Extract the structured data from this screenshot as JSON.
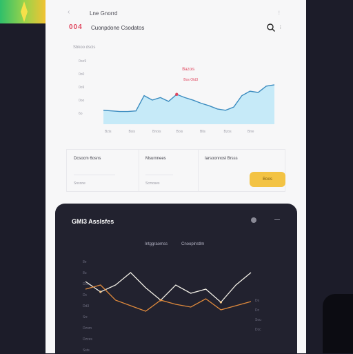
{
  "topbar": {
    "back_icon": "‹",
    "title": "Lne Gnorrd",
    "menu_icon": "⁝"
  },
  "header": {
    "logo": "004",
    "app_name": "Cuonpdone Csodatos"
  },
  "subtitle": "Sbkoo dscis",
  "chart1": {
    "y_ticks": [
      "0oo9",
      "0o0",
      "0o9",
      "0oo",
      "6o"
    ],
    "x_ticks": [
      "Bzis",
      "Bsis",
      "Bnois",
      "Bois",
      "Blis",
      "Bzos",
      "Brre"
    ],
    "annotation": {
      "title": "Bazois",
      "sub": "Bos Otd3"
    },
    "values": [
      22,
      21,
      20,
      20,
      21,
      45,
      38,
      42,
      36,
      47,
      42,
      38,
      33,
      29,
      24,
      22,
      27,
      45,
      52,
      50,
      60,
      62
    ],
    "colors": {
      "line": "#3a8bbf",
      "fill": "#c6eaf8",
      "marker": "#e0475f"
    }
  },
  "stats": [
    {
      "label": "Dcsocm 6osns",
      "sub": "Snxone"
    },
    {
      "label": "Msurnnees",
      "sub": "Scmoses"
    },
    {
      "label": "Iarsoonnosl Brsss",
      "sub": ""
    }
  ],
  "button": {
    "label": "Boos"
  },
  "dark_panel": {
    "title": "GMl3 Asslsfes",
    "tabs": [
      "Intggraomss",
      "Cnooplnstlm"
    ],
    "y_ticks": [
      "8e",
      "8u",
      "Dcs",
      "Dc",
      "Dd3",
      "Sn:",
      "Dzom",
      "Dzzes",
      "Ssts"
    ],
    "right_ticks": [
      "Ds",
      "Dc",
      "Sou",
      "Dzc"
    ],
    "series": [
      {
        "name": "",
        "color": "#f2efe6",
        "values": [
          25,
          40,
          30,
          12,
          34,
          52,
          30,
          42,
          36,
          55,
          30,
          12
        ]
      },
      {
        "name": "",
        "color": "#e08a3c",
        "values": [
          36,
          30,
          52,
          60,
          68,
          52,
          58,
          62,
          50,
          66,
          60,
          54
        ]
      }
    ]
  }
}
